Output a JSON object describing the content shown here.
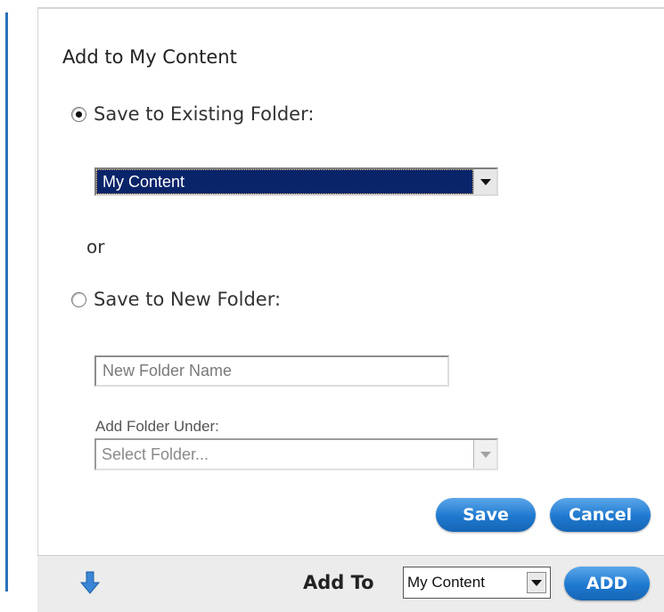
{
  "dialog": {
    "title": "Add to My Content",
    "existing_folder": {
      "label": "Save to Existing Folder:",
      "selected": true,
      "dropdown_value": "My Content"
    },
    "or_label": "or",
    "new_folder": {
      "label": "Save to New Folder:",
      "selected": false,
      "name_placeholder": "New Folder Name",
      "under_label": "Add Folder Under:",
      "under_placeholder": "Select Folder..."
    },
    "save_label": "Save",
    "cancel_label": "Cancel"
  },
  "bottom_bar": {
    "icon": "down-arrow-icon",
    "add_to_label": "Add To",
    "add_to_value": "My Content",
    "add_label": "ADD"
  },
  "colors": {
    "accent_blue": "#1f79cf",
    "selection_navy": "#0a246a"
  }
}
